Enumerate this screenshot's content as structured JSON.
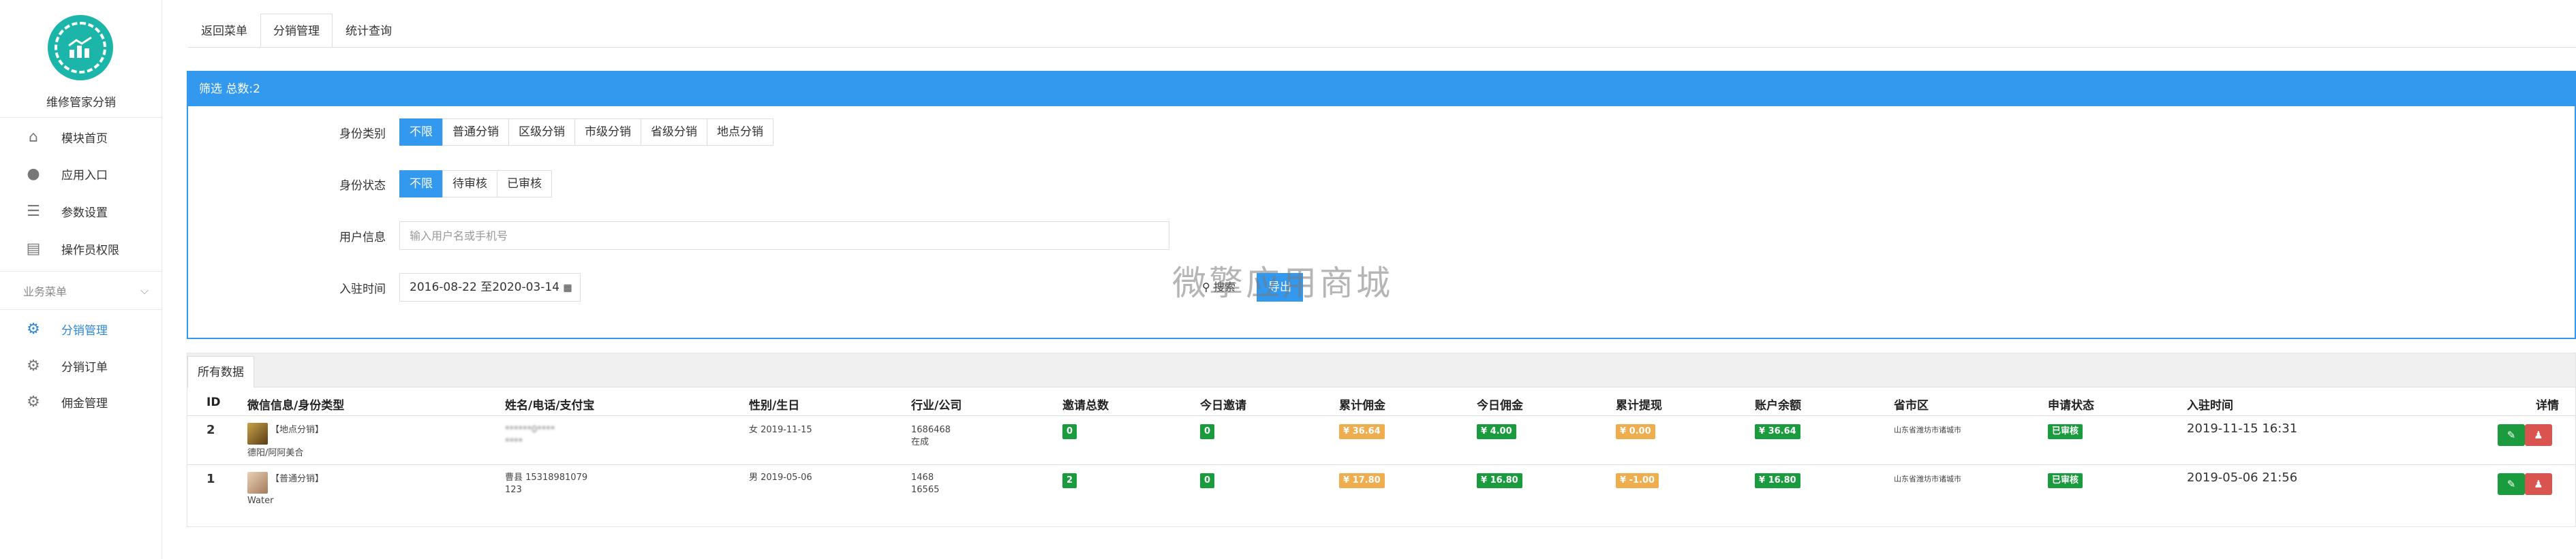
{
  "sidebar": {
    "app_name": "维修管家分销",
    "items": [
      {
        "label": "模块首页",
        "icon": "home-icon"
      },
      {
        "label": "应用入口",
        "icon": "chat-icon"
      },
      {
        "label": "参数设置",
        "icon": "list-icon"
      },
      {
        "label": "操作员权限",
        "icon": "document-icon"
      }
    ],
    "section_label": "业务菜单",
    "section_items": [
      {
        "label": "分销管理",
        "icon": "gear-icon",
        "active": true
      },
      {
        "label": "分销订单",
        "icon": "gear-icon"
      },
      {
        "label": "佣金管理",
        "icon": "gear-icon"
      }
    ]
  },
  "top_tabs": [
    "返回菜单",
    "分销管理",
    "统计查询"
  ],
  "filter": {
    "title": "筛选 总数:2",
    "identity_type_label": "身份类别",
    "identity_type_options": [
      "不限",
      "普通分销",
      "区级分销",
      "市级分销",
      "省级分销",
      "地点分销"
    ],
    "identity_status_label": "身份状态",
    "identity_status_options": [
      "不限",
      "待审核",
      "已审核"
    ],
    "user_info_label": "用户信息",
    "user_info_placeholder": "输入用户名或手机号",
    "join_time_label": "入驻时间",
    "join_time_value": "2016-08-22 至2020-03-14",
    "search_label": "搜索",
    "export_label": "导出"
  },
  "watermark": "微擎应用商城",
  "table": {
    "tab_label": "所有数据",
    "headers": [
      "ID",
      "微信信息/身份类型",
      "姓名/电话/支付宝",
      "性别/生日",
      "行业/公司",
      "邀请总数",
      "今日邀请",
      "累计佣金",
      "今日佣金",
      "累计提现",
      "账户余额",
      "省市区",
      "申请状态",
      "入驻时间",
      "详情"
    ],
    "rows": [
      {
        "id": "2",
        "wx_type": "【地点分销】",
        "wx_name": "德阳/阿阿美合",
        "name_phone_1": "******0****",
        "name_phone_2": "****",
        "gender_birthday": "女 2019-11-15",
        "industry": "1686468",
        "company": "在成",
        "invite_total": "0",
        "invite_today": "0",
        "commission_total": "¥ 36.64",
        "commission_today": "¥ 4.00",
        "withdraw_total": "¥ 0.00",
        "balance": "¥ 36.64",
        "region": "山东省潍坊市诸城市",
        "status": "已审核",
        "join_time": "2019-11-15 16:31"
      },
      {
        "id": "1",
        "wx_type": "【普通分销】",
        "wx_name": "Water",
        "name_phone_1": "曹县 15318981079",
        "name_phone_2": "123",
        "gender_birthday": "男 2019-05-06",
        "industry": "1468",
        "company": "16565",
        "invite_total": "2",
        "invite_today": "0",
        "commission_total": "¥ 17.80",
        "commission_today": "¥ 16.80",
        "withdraw_total": "¥ -1.00",
        "balance": "¥ 16.80",
        "region": "山东省潍坊市诸城市",
        "status": "已审核",
        "join_time": "2019-05-06 21:56"
      }
    ]
  },
  "colors": {
    "primary": "#3399ee",
    "success": "#1a9c3e",
    "warning": "#f0ad4e",
    "danger": "#d9534f"
  }
}
